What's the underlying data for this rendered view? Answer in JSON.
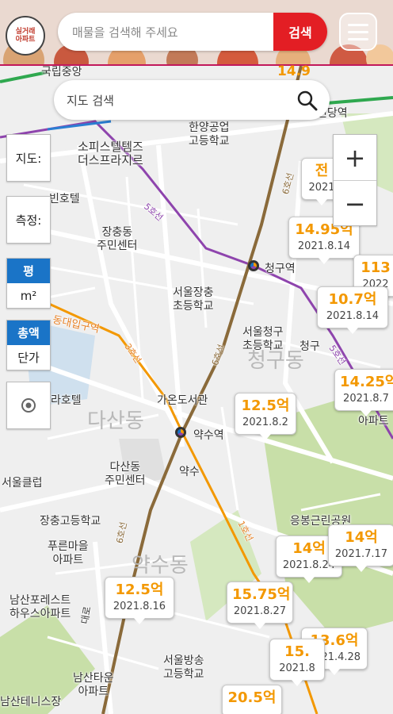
{
  "header": {
    "logo_text": "실거래\n아파트",
    "search_placeholder": "매물을 검색해 주세요",
    "search_button": "검색",
    "top_strip_price": "14.9"
  },
  "map_search": {
    "placeholder": "지도 검색"
  },
  "controls": {
    "map_label": "지도:",
    "measure_label": "측정:",
    "unit_on": "평",
    "unit_off": "m²",
    "price_on": "총액",
    "price_off": "단가",
    "zoom_in": "+",
    "zoom_out": "−"
  },
  "map_labels": {
    "l01": "국립중앙",
    "l02": "신당역",
    "l03": "한양공업\n고등학교",
    "l04": "소피스텔템즈\n더스프라지르",
    "l05": "빈호텔",
    "l06": "장충동\n주민센터",
    "l07": "청구역",
    "l08": "서울장충\n초등학교",
    "l09": "서울청구\n초등학교",
    "l10": "청구",
    "l11": "청구동",
    "l12": "동대입구역",
    "l13": "라호텔",
    "l14": "가온도서관",
    "l15": "다산동",
    "l16": "약수역",
    "l17": "다산동\n주민센터",
    "l18": "약수",
    "l19": "서울클럽",
    "l20": "장충고등학교",
    "l21": "푸른마을\n아파트",
    "l22": "응봉근린공원",
    "l23": "약수동",
    "l24": "남산포레스트\n하우스아파트",
    "l25": "서울방송\n고등학교",
    "l26": "남산타운\n아파트",
    "l27": "남산테니스장",
    "l28": "아파트",
    "l29": "대로",
    "l30": "6호선",
    "l31": "5호선",
    "l32": "6호선",
    "l33": "5호선",
    "l34": "6호선",
    "l35": "3호선",
    "l36": "1호선"
  },
  "price_pins": [
    {
      "price": "전",
      "date": "2021"
    },
    {
      "price": "14.95억",
      "date": "2021.8.14"
    },
    {
      "price": "113",
      "date": "2022"
    },
    {
      "price": "10.7억",
      "date": "2021.8.14"
    },
    {
      "price": "14.25억",
      "date": "2021.8.7"
    },
    {
      "price": "12.5억",
      "date": "2021.8.2"
    },
    {
      "price": "14억",
      "date": "2021.8.24"
    },
    {
      "price": "14억",
      "date": "2021.7.17"
    },
    {
      "price": "12.5억",
      "date": "2021.8.16"
    },
    {
      "price": "15.75억",
      "date": "2021.8.27"
    },
    {
      "price": "13.6억",
      "date": "2021.4.28"
    },
    {
      "price": "15.",
      "date": "2021.8"
    },
    {
      "price": "20.5억",
      "date": ""
    }
  ],
  "colors": {
    "brand_red": "#e31e24",
    "line_5": "#8e44ad",
    "line_6": "#b5651d",
    "line_3": "#f39800",
    "toggle_blue": "#1a74c7",
    "price_orange": "#f39800"
  }
}
